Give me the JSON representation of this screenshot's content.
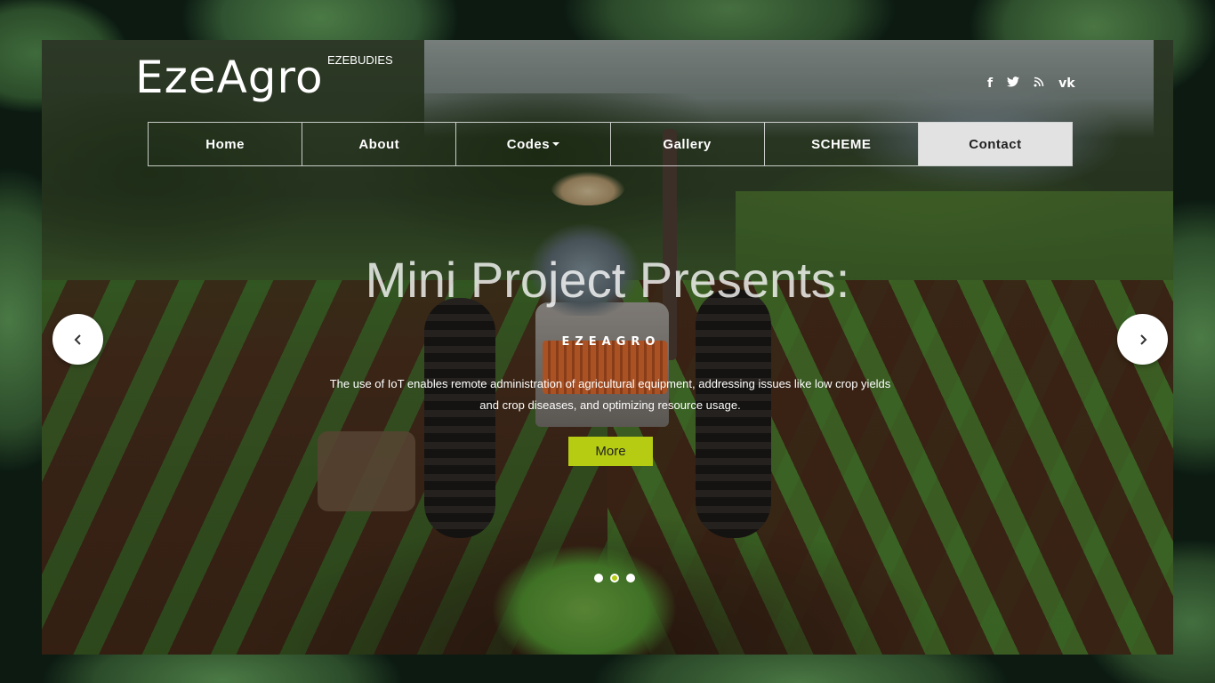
{
  "brand": {
    "logo": "EzeAgro",
    "subtitle": "EZEBUDIES"
  },
  "social": [
    {
      "icon": "facebook-icon",
      "glyph": "f"
    },
    {
      "icon": "twitter-icon",
      "glyph": "🐦"
    },
    {
      "icon": "rss-icon",
      "glyph": "⟟"
    },
    {
      "icon": "vk-icon",
      "glyph": "vk"
    }
  ],
  "nav": {
    "items": [
      {
        "label": "Home"
      },
      {
        "label": "About"
      },
      {
        "label": "Codes"
      },
      {
        "label": "Gallery"
      },
      {
        "label": "SCHEME"
      },
      {
        "label": "Contact"
      }
    ],
    "active": "Contact"
  },
  "slide": {
    "headline": "Mini Project Presents:",
    "brand_text": "EZEAGRO",
    "description": "The use of IoT enables remote administration of agricultural equipment, addressing issues like low crop yields and crop diseases, and optimizing resource usage.",
    "button_label": "More"
  },
  "carousel": {
    "slides": 3,
    "active_index": 1
  },
  "colors": {
    "accent": "#b6cc12",
    "active_nav_bg": "#e2e2e2"
  }
}
